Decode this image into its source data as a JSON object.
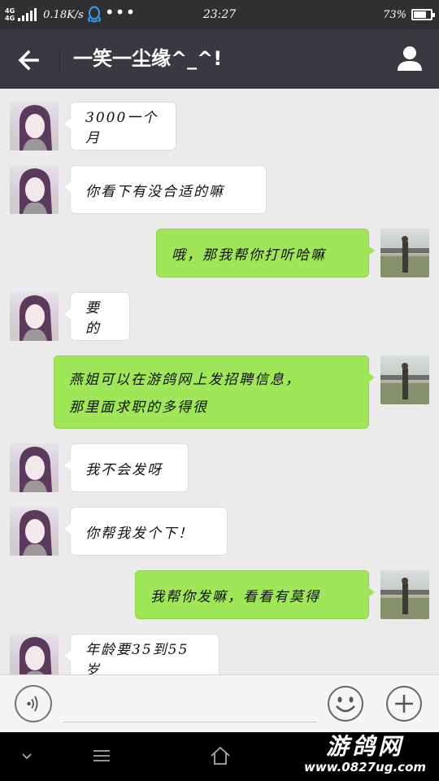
{
  "status_bar": {
    "network": "4G",
    "network2": "4G",
    "speed": "0.18K/s",
    "time": "23:27",
    "battery": "73%",
    "battery_level": 0.73
  },
  "header": {
    "title": "一笑一尘缘^_^!"
  },
  "messages": [
    {
      "side": "in",
      "text": "3000一个月"
    },
    {
      "side": "in",
      "text": "你看下有没合适的嘛"
    },
    {
      "side": "out",
      "text": "哦，那我帮你打听哈嘛"
    },
    {
      "side": "in",
      "text": "要的"
    },
    {
      "side": "out",
      "lines": [
        "燕姐可以在游鸽网上发招聘信息，",
        "那里面求职的多得很"
      ]
    },
    {
      "side": "in",
      "text": "我不会发呀"
    },
    {
      "side": "in",
      "text": "你帮我发个下！"
    },
    {
      "side": "out",
      "text": "我帮你发嘛，看看有莫得"
    },
    {
      "side": "in",
      "text": "年龄要35到55岁"
    }
  ],
  "input_bar": {
    "placeholder": ""
  },
  "watermark": {
    "name": "游鸽网",
    "url": "www.0827ug.com"
  },
  "colors": {
    "status_bar_bg": "#2e3032",
    "header_bg": "#393a3f",
    "chat_bg": "#ebebeb",
    "outgoing_bubble": "#9fe658",
    "incoming_bubble": "#ffffff"
  }
}
